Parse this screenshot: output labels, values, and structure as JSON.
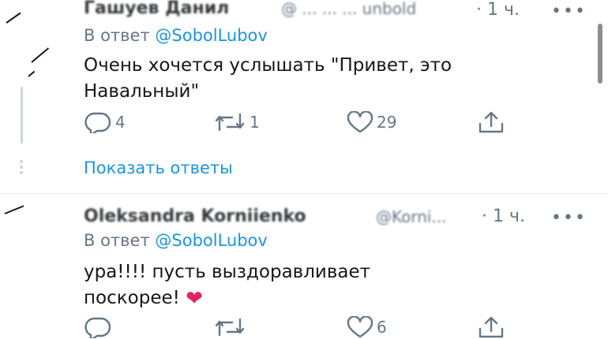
{
  "tweets": [
    {
      "name": "Гашуев Данил",
      "handle": "@ ... ... ... unbold",
      "time": "· 1 ч.",
      "more": "•••",
      "reply_prefix": "В ответ",
      "reply_mention": "@SobolLubov",
      "text_line1": "Очень хочется услышать \"Привет, это",
      "text_line2": "Навальный\"",
      "replies": "4",
      "retweets": "1",
      "likes": "29",
      "show_replies": "Показать ответы"
    },
    {
      "name": "Oleksandra Korniienko",
      "handle": "@Korni...",
      "time": "· 1 ч.",
      "more": "•••",
      "reply_prefix": "В ответ",
      "reply_mention": "@SobolLubov",
      "text_line1": "ура!!!! пусть выздоравливает",
      "text_line2": "поскорее!",
      "emoji": "❤",
      "replies": "",
      "retweets": "",
      "likes": "6"
    }
  ],
  "colors": {
    "link": "#1b95e0",
    "secondary": "#657786",
    "text": "#14171a",
    "divider": "#e6ecf0"
  }
}
